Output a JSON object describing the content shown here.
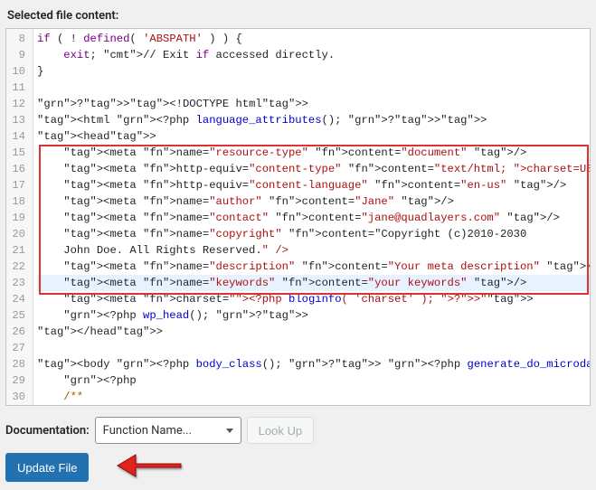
{
  "header": {
    "title": "Selected file content:"
  },
  "editor": {
    "startLine": 8,
    "highlightLine": 23,
    "redBox": {
      "startLine": 15,
      "endLine": 23
    },
    "lines": [
      "if ( ! defined( 'ABSPATH' ) ) {",
      "    exit; // Exit if accessed directly.",
      "}",
      "",
      "?><!DOCTYPE html>",
      "<html <?php language_attributes(); ?>>",
      "<head>",
      "    <meta name=\"resource-type\" content=\"document\" />",
      "    <meta http-equiv=\"content-type\" content=\"text/html; charset=US-ASCII\" />",
      "    <meta http-equiv=\"content-language\" content=\"en-us\" />",
      "    <meta name=\"author\" content=\"Jane\" />",
      "    <meta name=\"contact\" content=\"jane@quadlayers.com\" />",
      "    <meta name=\"copyright\" content=\"Copyright (c)2010-2030",
      "    John Doe. All Rights Reserved.\" />",
      "    <meta name=\"description\" content=\"Your meta description\" />",
      "    <meta name=\"keywords\" content=\"your keywords\" />",
      "    <meta charset=\"<?php bloginfo( 'charset' ); ?>\">",
      "    <?php wp_head(); ?>",
      "</head>",
      "",
      "<body <?php body_class(); ?> <?php generate_do_microdata( 'body' ); ?>>",
      "    <?php",
      "    /**"
    ]
  },
  "doc": {
    "label": "Documentation:",
    "selectValue": "Function Name...",
    "lookup": "Look Up"
  },
  "actions": {
    "updateFile": "Update File"
  }
}
